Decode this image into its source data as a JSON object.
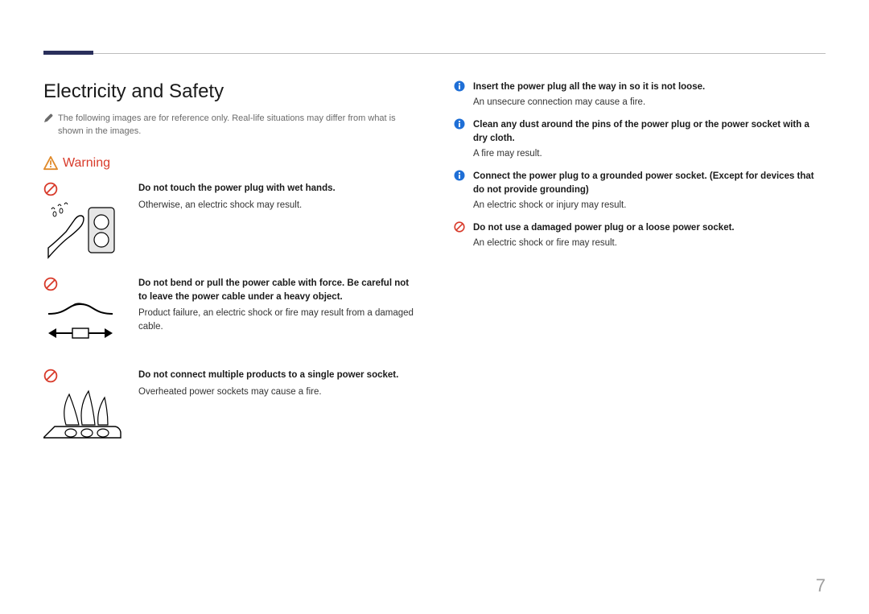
{
  "section_title": "Electricity and Safety",
  "note": "The following images are for reference only. Real-life situations may differ from what is shown in the images.",
  "warning_label": "Warning",
  "left_items": [
    {
      "bold": "Do not touch the power plug with wet hands.",
      "sub": "Otherwise, an electric shock may result."
    },
    {
      "bold": "Do not bend or pull the power cable with force. Be careful not to leave the power cable under a heavy object.",
      "sub": "Product failure, an electric shock or fire may result from a damaged cable."
    },
    {
      "bold": "Do not connect multiple products to a single power socket.",
      "sub": "Overheated power sockets may cause a fire."
    }
  ],
  "right_items": [
    {
      "icon": "info",
      "bold": "Insert the power plug all the way in so it is not loose.",
      "sub": "An unsecure connection may cause a fire."
    },
    {
      "icon": "info",
      "bold": "Clean any dust around the pins of the power plug or the power socket with a dry cloth.",
      "sub": "A fire may result."
    },
    {
      "icon": "info",
      "bold": "Connect the power plug to a grounded power socket. (Except for devices that do not provide grounding)",
      "sub": "An electric shock or injury may result."
    },
    {
      "icon": "prohibit",
      "bold": "Do not use a damaged power plug or a loose power socket.",
      "sub": "An electric shock or fire may result."
    }
  ],
  "page_number": "7"
}
